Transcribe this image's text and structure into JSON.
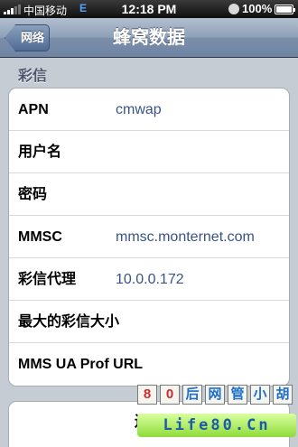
{
  "status_bar": {
    "carrier": "中国移动",
    "network": "E",
    "time": "12:18 PM",
    "battery_percent": "100%",
    "battery_level": 1.0,
    "signal_bars": 3
  },
  "nav": {
    "back_label": "网络",
    "title": "蜂窝数据"
  },
  "section": {
    "header": "彩信",
    "rows": [
      {
        "label": "APN",
        "value": "cmwap"
      },
      {
        "label": "用户名",
        "value": ""
      },
      {
        "label": "密码",
        "value": ""
      },
      {
        "label": "MMSC",
        "value": "mmsc.monternet.com"
      },
      {
        "label": "彩信代理",
        "value": "10.0.0.172"
      },
      {
        "label": "最大的彩信大小",
        "value": ""
      },
      {
        "label": "MMS UA Prof URL",
        "value": ""
      }
    ]
  },
  "reset": {
    "label": "还原"
  },
  "watermark": {
    "top_chars": [
      "8",
      "0",
      "后",
      "网",
      "管",
      "小",
      "胡"
    ],
    "bottom_text": "Life80.Cn"
  },
  "colors": {
    "nav_gradient_top": "#b2bfcf",
    "nav_gradient_bottom": "#6e84a2",
    "background": "#c5ccd4",
    "value_text": "#385487",
    "section_header": "#4c566c"
  },
  "icons": {
    "signal": "signal-bars-icon",
    "lock": "rotation-lock-icon",
    "battery": "battery-icon",
    "back": "back-arrow-button"
  }
}
